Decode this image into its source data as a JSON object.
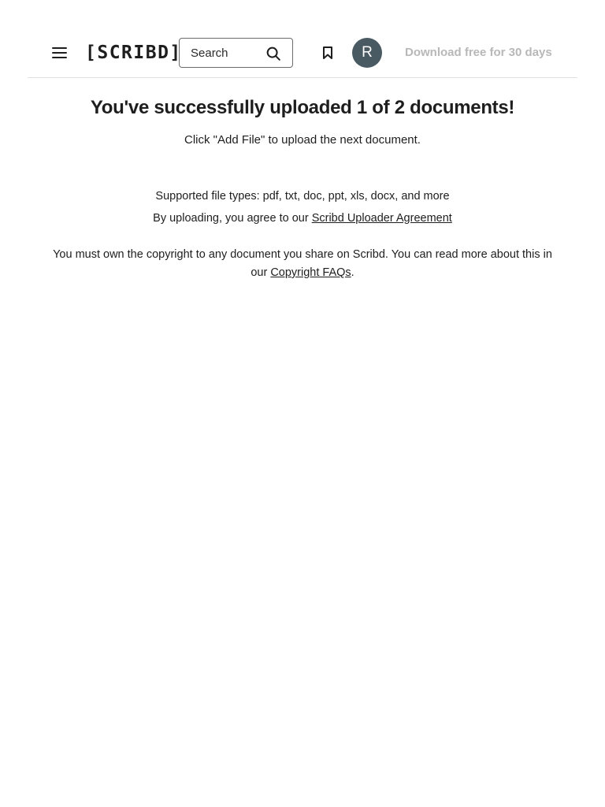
{
  "header": {
    "logo": "[SCRIBD]",
    "search": {
      "placeholder": "Search",
      "value": ""
    },
    "avatar_initial": "R",
    "download_link": "Download free for 30 days",
    "icons": {
      "menu": "hamburger-menu-icon",
      "search": "search-icon",
      "bookmark": "bookmark-icon"
    }
  },
  "main": {
    "title": "You've successfully uploaded 1 of 2 documents!",
    "subtitle": "Click \"Add File\" to upload the next document.",
    "supported_types": "Supported file types: pdf, txt, doc, ppt, xls, docx, and more",
    "agreement_prefix": "By uploading, you agree to our ",
    "agreement_link": "Scribd Uploader Agreement",
    "copyright_prefix": "You must own the copyright to any document you share on Scribd. You can read more about this in our ",
    "copyright_link": "Copyright FAQs",
    "copyright_suffix": "."
  },
  "colors": {
    "text": "#1e1e1e",
    "muted": "#b8b8b8",
    "avatar_bg": "#4a5a63",
    "divider": "#e2e2e2"
  }
}
